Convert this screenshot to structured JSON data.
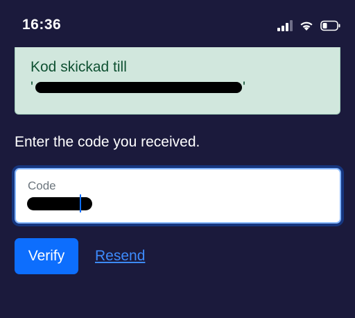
{
  "status_bar": {
    "time": "16:36",
    "icons": [
      "cellular-signal-icon",
      "wifi-icon",
      "battery-icon"
    ]
  },
  "alert": {
    "message": "Kod skickad till",
    "recipient_redacted": true
  },
  "verify_form": {
    "instruction": "Enter the code you received.",
    "code_label": "Code",
    "code_value_redacted": true
  },
  "actions": {
    "verify_label": "Verify",
    "resend_label": "Resend"
  },
  "colors": {
    "background": "#1b1a3c",
    "alert_bg": "#d1e7dd",
    "alert_text": "#0f5132",
    "primary": "#0d6efd",
    "link": "#3d8bfd"
  }
}
